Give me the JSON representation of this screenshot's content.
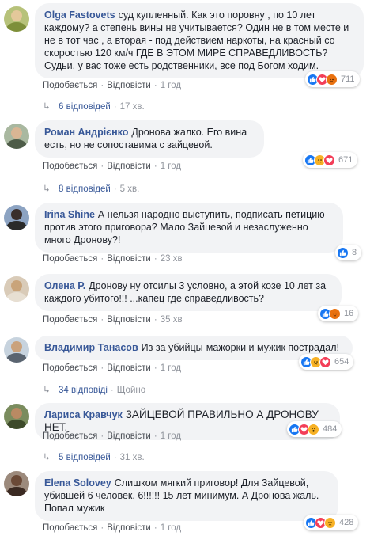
{
  "colors": {
    "like": "#1877f2",
    "love": "#f33e58",
    "angry": "#e9710f",
    "sad": "#f7b125",
    "author": "#385898"
  },
  "comments": [
    {
      "author": "Olga Fastovets",
      "text": "суд купленный. Как это поровну , по 10 лет каждому? а степень вины не учитывается? Один не в том месте и не в тот час , а вторая - под действием наркоты, на красный со скоростью 120 км/ч ГДЕ В ЭТОМ МИРЕ СПРАВЕДЛИВОСТЬ? Судьи, у вас тоже есть родственники, все под Богом ходим.",
      "like": "Подобається",
      "reply": "Відповісти",
      "time": "1 год",
      "reactions": [
        "like-icon",
        "love-icon",
        "angry-icon"
      ],
      "count": "711",
      "replies": {
        "count": "6 відповідей",
        "time": "17 хв."
      }
    },
    {
      "author": "Роман Андрієнко",
      "text": "Дронова жалко. Его вина есть, но не сопоставима с зайцевой.",
      "like": "Подобається",
      "reply": "Відповісти",
      "time": "1 год",
      "reactions": [
        "like-icon",
        "sad-icon",
        "love-icon"
      ],
      "count": "671",
      "replies": {
        "count": "8 відповідей",
        "time": "5 хв."
      }
    },
    {
      "author": "Irina Shine",
      "text": "А нельзя народно выступить, подписать петицию против этого приговора? Мало Зайцевой и незаслуженно много Дронову?!",
      "like": "Подобається",
      "reply": "Відповісти",
      "time": "23 хв",
      "reactions": [
        "like-icon"
      ],
      "count": "8"
    },
    {
      "author": "Олена Р.",
      "text": "Дронову ну отсилы 3 условно, а этой козе 10 лет за каждого убитого!!! ...капец где справедливость?",
      "like": "Подобається",
      "reply": "Відповісти",
      "time": "35 хв",
      "reactions": [
        "like-icon",
        "angry-icon"
      ],
      "count": "16"
    },
    {
      "author": "Владимир Танасов",
      "text": "Из за убийцы-мажорки и мужик пострадал!",
      "like": "Подобається",
      "reply": "Відповісти",
      "time": "1 год",
      "reactions": [
        "like-icon",
        "sad-icon",
        "love-icon"
      ],
      "count": "654",
      "replies": {
        "count": "34 відповіді",
        "time": "Щойно"
      }
    },
    {
      "author": "Лариса Кравчук",
      "text": "ЗАЙЦЕВОЙ ПРАВИЛЬНО А ДРОНОВУ НЕТ.",
      "like": "Подобається",
      "reply": "Відповісти",
      "time": "1 год",
      "reactions": [
        "like-icon",
        "love-icon",
        "wow-icon"
      ],
      "count": "484",
      "replies": {
        "count": "5 відповідей",
        "time": "31 хв."
      }
    },
    {
      "author": "Elena Solovey",
      "text": "Слишком мягкий приговор! Для Зайцевой, убившей 6 человек. 6!!!!!! 15 лет минимум. А Дронова жаль. Попал мужик",
      "like": "Подобається",
      "reply": "Відповісти",
      "time": "1 год",
      "reactions": [
        "like-icon",
        "love-icon",
        "sad-icon"
      ],
      "count": "428"
    }
  ]
}
